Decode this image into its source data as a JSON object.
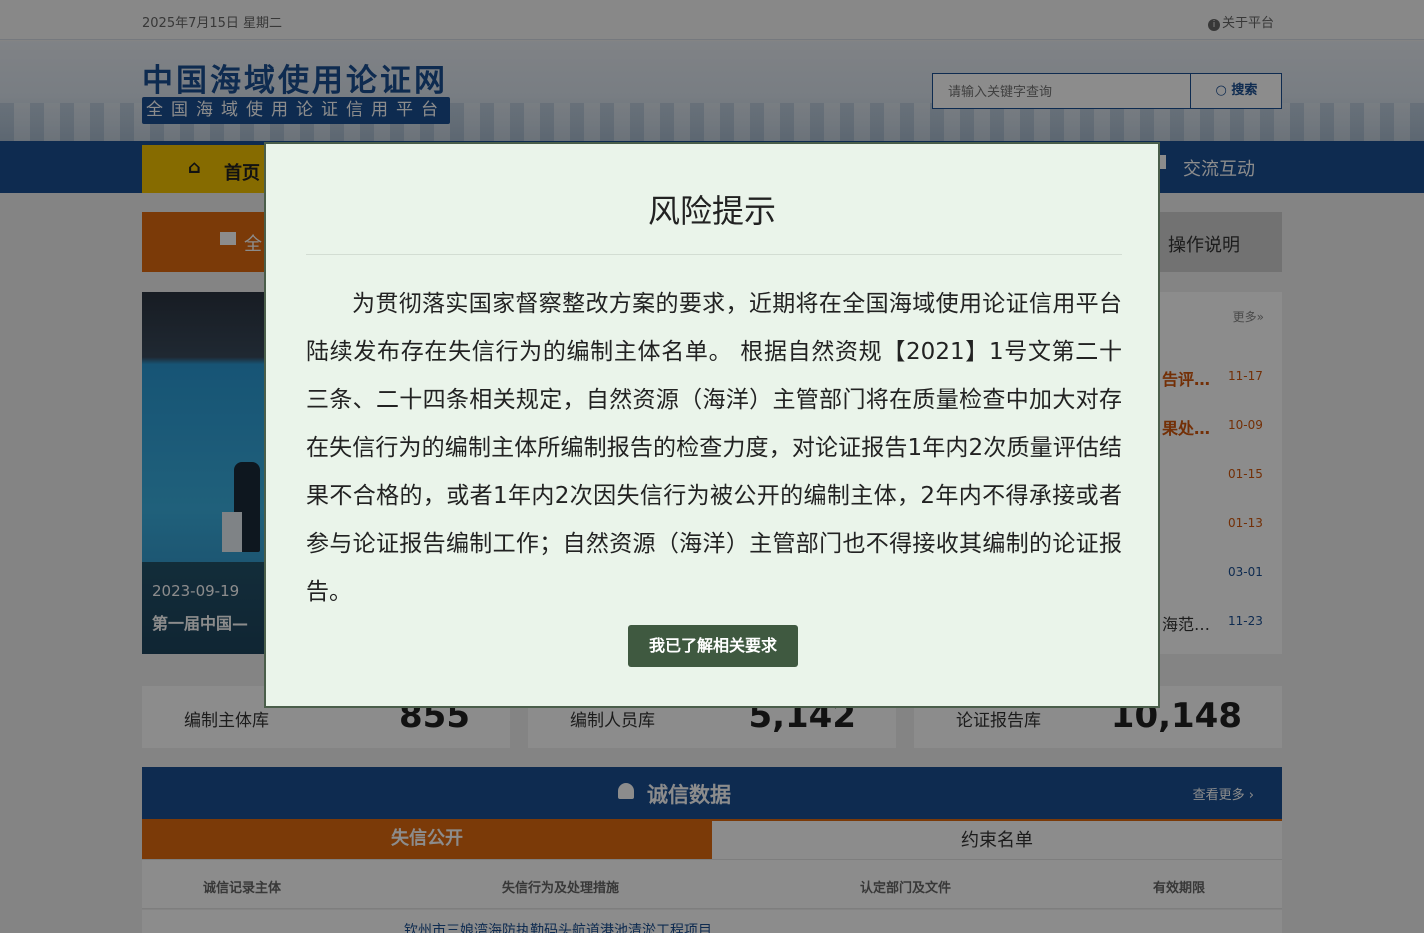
{
  "topbar": {
    "date": "2025年7月15日 星期二",
    "about": "关于平台"
  },
  "header": {
    "logo_title": "中国海域使用论证网",
    "logo_subtitle": "全国海域使用论证信用平台",
    "search_placeholder": "请输入关键字查询",
    "search_button": "搜索"
  },
  "nav": {
    "home": "首页",
    "interact": "交流互动"
  },
  "tabs": {
    "orange": "全",
    "ops": "操作说明"
  },
  "photo": {
    "date": "2023-09-19",
    "title": "第一届中国—"
  },
  "news": {
    "more": "更多»",
    "items": [
      {
        "title": "告评…",
        "date": "11-17"
      },
      {
        "title": "果处…",
        "date": "10-09"
      },
      {
        "title": "",
        "date": "01-15"
      },
      {
        "title": "",
        "date": "01-13"
      },
      {
        "title": "",
        "date": "03-01"
      },
      {
        "title": "海范…",
        "date": "11-23"
      }
    ]
  },
  "stats": [
    {
      "label": "编制主体库",
      "value": "855"
    },
    {
      "label": "编制人员库",
      "value": "5,142"
    },
    {
      "label": "论证报告库",
      "value": "10,148"
    }
  ],
  "credit": {
    "title": "诚信数据",
    "more": "查看更多 ›",
    "tab_active": "失信公开",
    "tab_other": "约束名单",
    "columns": [
      "诚信记录主体",
      "失信行为及处理措施",
      "认定部门及文件",
      "有效期限"
    ],
    "first_row_text": "钦州市三娘湾海防执勤码头航道港池清淤工程项目"
  },
  "modal": {
    "title": "风险提示",
    "body": "为贯彻落实国家督察整改方案的要求，近期将在全国海域使用论证信用平台陆续发布存在失信行为的编制主体名单。 根据自然资规【2021】1号文第二十三条、二十四条相关规定，自然资源（海洋）主管部门将在质量检查中加大对存在失信行为的编制主体所编制报告的检查力度，对论证报告1年内2次质量评估结果不合格的，或者1年内2次因失信行为被公开的编制主体，2年内不得承接或者参与论证报告编制工作；自然资源（海洋）主管部门也不得接收其编制的论证报告。",
    "button": "我已了解相关要求"
  }
}
